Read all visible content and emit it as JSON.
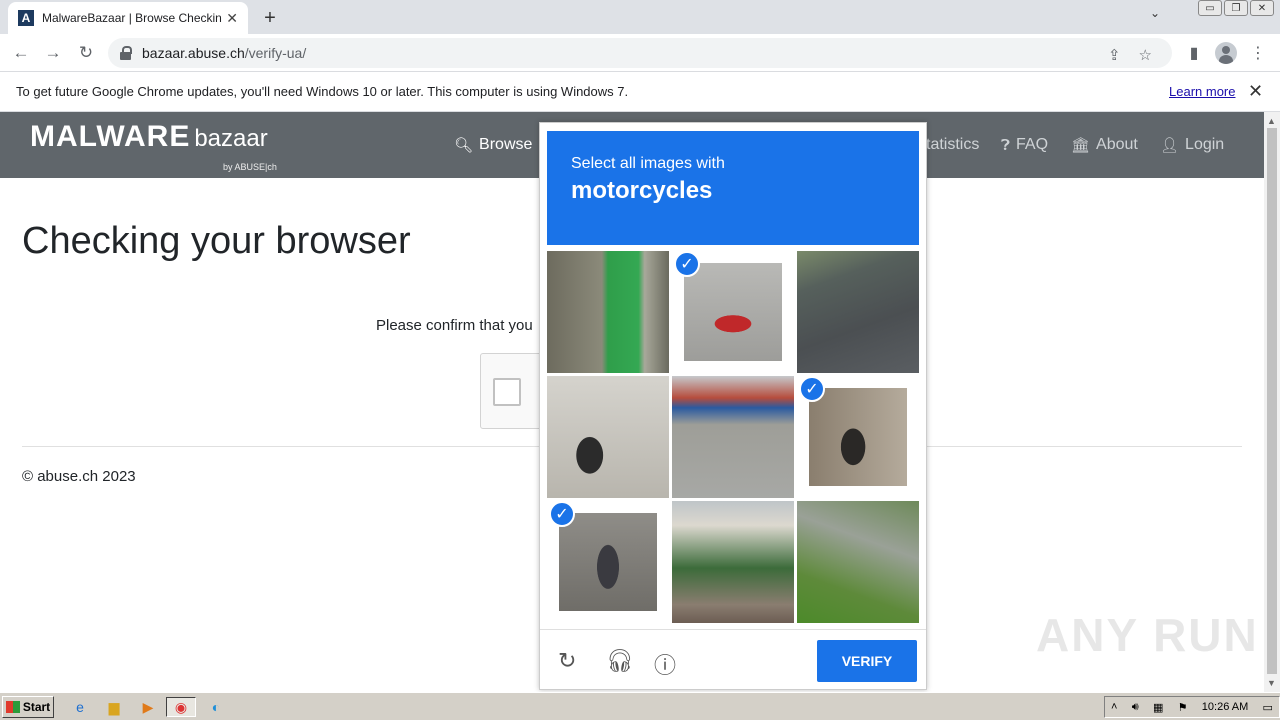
{
  "browser": {
    "tab_title": "MalwareBazaar | Browse Checking y",
    "tab_close": "✕",
    "new_tab": "+",
    "url_host": "bazaar.abuse.ch",
    "url_path": "/verify-ua/"
  },
  "infobar": {
    "message": "To get future Google Chrome updates, you'll need Windows 10 or later. This computer is using Windows 7.",
    "learn_more": "Learn more",
    "close": "✕"
  },
  "site": {
    "logo_main": "MALWARE",
    "logo_sub": "bazaar",
    "logo_by": "by ABUSE|ch",
    "nav": [
      {
        "label": "Browse",
        "icon": "search-icon"
      },
      {
        "label": "Statistics",
        "icon": "chart-icon"
      },
      {
        "label": "FAQ",
        "icon": "question-icon"
      },
      {
        "label": "About",
        "icon": "building-icon"
      },
      {
        "label": "Login",
        "icon": "user-icon"
      }
    ],
    "nav_stat_visible": "tatistics",
    "heading": "Checking your browser",
    "confirm_text": "Please confirm that you",
    "copyright": "© abuse.ch 2023"
  },
  "captcha": {
    "instruction": "Select all images with",
    "target": "motorcycles",
    "verify_label": "VERIFY",
    "selected_tiles": [
      1,
      5,
      6
    ],
    "icons": [
      "reload-icon",
      "audio-icon",
      "info-icon"
    ]
  },
  "watermark": "ANY RUN",
  "taskbar": {
    "start_label": "Start",
    "clock": "10:26 AM"
  },
  "colors": {
    "navbar": "#60666b",
    "captcha_blue": "#1a73e8"
  }
}
